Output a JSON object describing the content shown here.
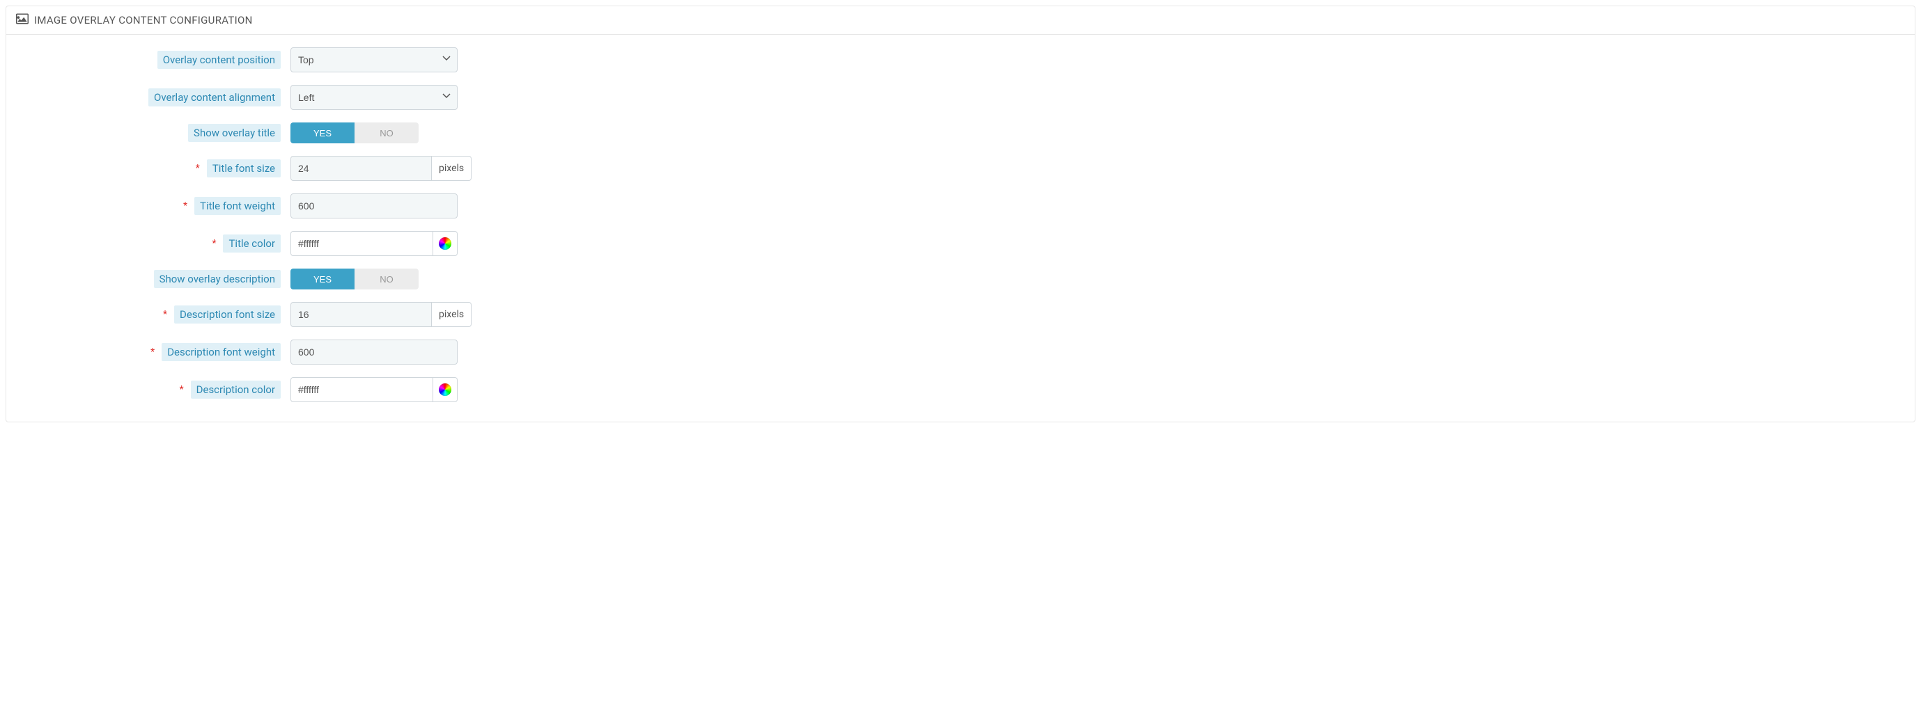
{
  "panel": {
    "title": "IMAGE OVERLAY CONTENT CONFIGURATION"
  },
  "labels": {
    "overlay_position": "Overlay content position",
    "overlay_alignment": "Overlay content alignment",
    "show_title": "Show overlay title",
    "title_font_size": "Title font size",
    "title_font_weight": "Title font weight",
    "title_color": "Title color",
    "show_description": "Show overlay description",
    "desc_font_size": "Description font size",
    "desc_font_weight": "Description font weight",
    "desc_color": "Description color"
  },
  "values": {
    "overlay_position": "Top",
    "overlay_alignment": "Left",
    "title_font_size": "24",
    "title_font_weight": "600",
    "title_color": "#ffffff",
    "desc_font_size": "16",
    "desc_font_weight": "600",
    "desc_color": "#ffffff"
  },
  "toggle": {
    "yes": "YES",
    "no": "NO"
  },
  "units": {
    "pixels": "pixels"
  },
  "required_marker": "*"
}
